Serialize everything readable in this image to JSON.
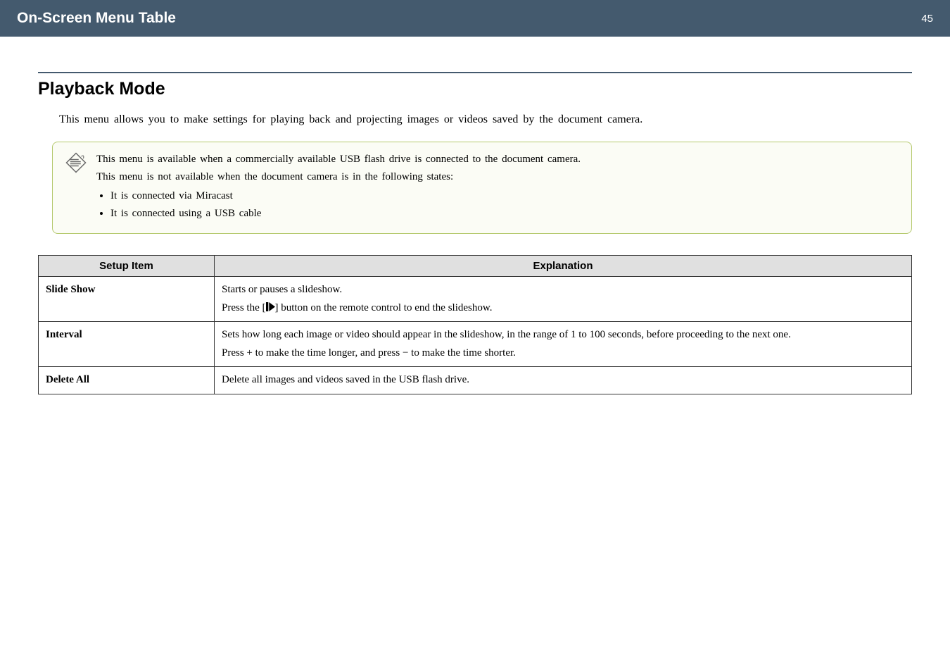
{
  "header": {
    "title": "On-Screen Menu Table",
    "page_number": "45"
  },
  "section": {
    "title": "Playback Mode",
    "intro": "This menu allows you to make settings for playing back and projecting images or videos saved by the document camera."
  },
  "note": {
    "line1": "This menu is available when a commercially available USB flash drive is connected to the document camera.",
    "line2": "This menu is not available when the document camera is in the following states:",
    "bullet1": "It is connected via Miracast",
    "bullet2": "It is connected using a USB cable"
  },
  "table": {
    "headers": {
      "col1": "Setup Item",
      "col2": "Explanation"
    },
    "rows": [
      {
        "item": "Slide Show",
        "exp_line1": "Starts or pauses a slideshow.",
        "exp_line2a": "Press the [",
        "exp_line2b": "] button on the remote control to end the slideshow."
      },
      {
        "item": "Interval",
        "exp_line1": "Sets how long each image or video should appear in the slideshow, in the range of 1 to 100 seconds, before proceeding to the next one.",
        "exp_line2": "Press + to make the time longer, and press − to make the time shorter."
      },
      {
        "item": "Delete All",
        "exp": "Delete all images and videos saved in the USB flash drive."
      }
    ]
  }
}
